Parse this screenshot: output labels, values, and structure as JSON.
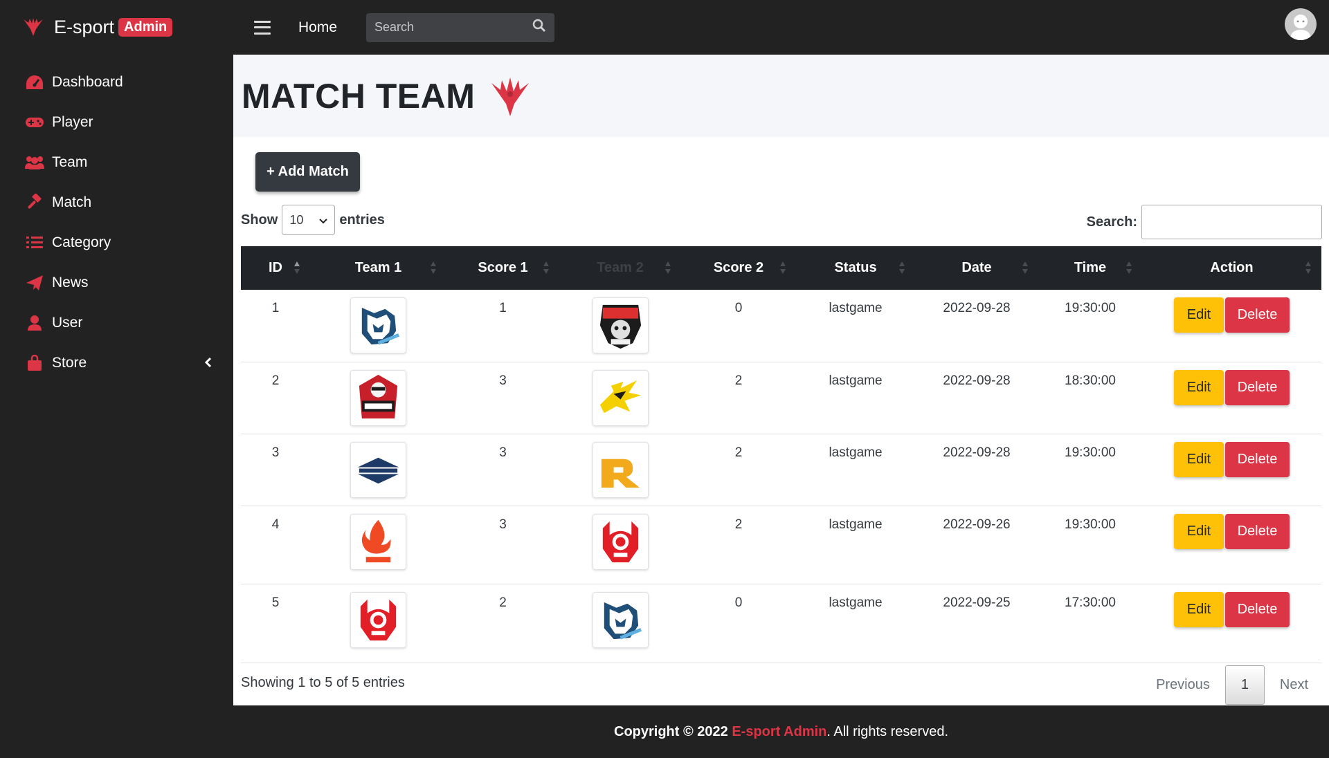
{
  "brand": {
    "name": "E-sport",
    "badge": "Admin",
    "logo_icon": "phoenix-logo"
  },
  "sidebar": {
    "items": [
      {
        "label": "Dashboard",
        "icon": "gauge-icon"
      },
      {
        "label": "Player",
        "icon": "gamepad-icon"
      },
      {
        "label": "Team",
        "icon": "users-icon"
      },
      {
        "label": "Match",
        "icon": "gavel-icon"
      },
      {
        "label": "Category",
        "icon": "list-icon"
      },
      {
        "label": "News",
        "icon": "paper-plane-icon"
      },
      {
        "label": "User",
        "icon": "user-icon"
      },
      {
        "label": "Store",
        "icon": "shopping-bag-icon",
        "expand_icon": "chevron-left-icon"
      }
    ]
  },
  "topbar": {
    "home_label": "Home",
    "search_placeholder": "Search"
  },
  "page": {
    "title": "MATCH TEAM"
  },
  "toolbar": {
    "add_label": "+ Add Match"
  },
  "table_controls": {
    "show_label": "Show",
    "entries_value": "10",
    "entries_label": "entries",
    "search_label": "Search:"
  },
  "table": {
    "columns": [
      "ID",
      "Team 1",
      "Score 1",
      "Team 2",
      "Score 2",
      "Status",
      "Date",
      "Time",
      "Action"
    ],
    "rows": [
      {
        "id": "1",
        "team1": "EVOS",
        "score1": "1",
        "team2": "Alter Ego",
        "score2": "0",
        "status": "lastgame",
        "date": "2022-09-28",
        "time": "19:30:00"
      },
      {
        "id": "2",
        "team1": "Geek Fam",
        "score1": "3",
        "team2": "ONIC",
        "score2": "2",
        "status": "lastgame",
        "date": "2022-09-28",
        "time": "18:30:00"
      },
      {
        "id": "3",
        "team1": "Rebellion",
        "score1": "3",
        "team2": "RRQ",
        "score2": "2",
        "status": "lastgame",
        "date": "2022-09-28",
        "time": "19:30:00"
      },
      {
        "id": "4",
        "team1": "Aura",
        "score1": "3",
        "team2": "Bigetron",
        "score2": "2",
        "status": "lastgame",
        "date": "2022-09-26",
        "time": "19:30:00"
      },
      {
        "id": "5",
        "team1": "Bigetron",
        "score1": "2",
        "team2": "EVOS",
        "score2": "0",
        "status": "lastgame",
        "date": "2022-09-25",
        "time": "17:30:00"
      }
    ],
    "edit_label": "Edit",
    "delete_label": "Delete"
  },
  "pagination": {
    "info": "Showing 1 to 5 of 5 entries",
    "previous": "Previous",
    "current": "1",
    "next": "Next"
  },
  "footer": {
    "prefix": "Copyright © 2022 ",
    "brand": "E-sport Admin",
    "suffix": ". All rights reserved."
  },
  "colors": {
    "sidebar_bg": "#222222",
    "accent": "#dc3545",
    "warning": "#ffc107",
    "table_head": "#212529"
  }
}
